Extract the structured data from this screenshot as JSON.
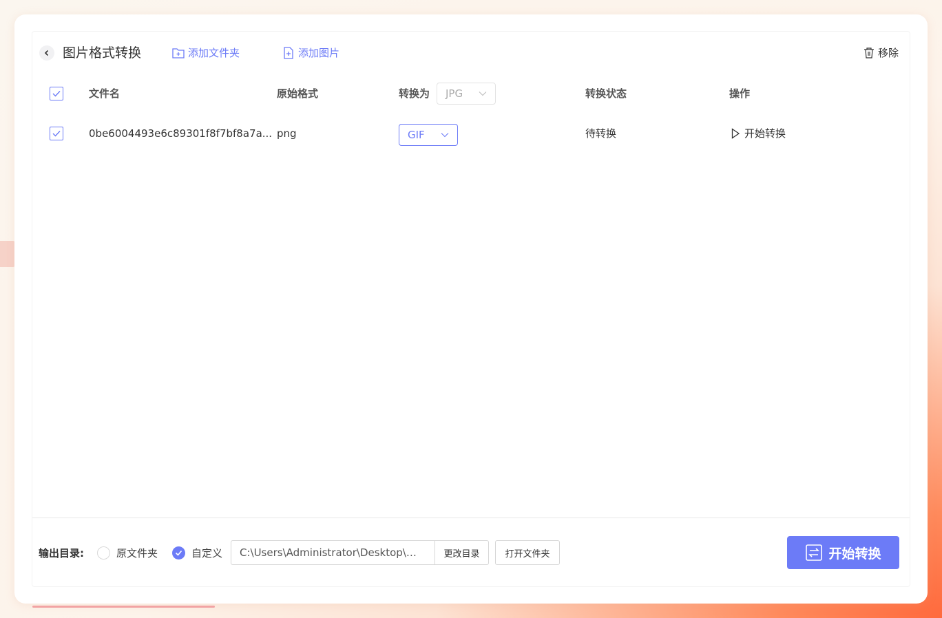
{
  "header": {
    "title": "图片格式转换",
    "add_folder": "添加文件夹",
    "add_image": "添加图片",
    "remove": "移除"
  },
  "table": {
    "columns": {
      "filename": "文件名",
      "original_format": "原始格式",
      "convert_to": "转换为",
      "status": "转换状态",
      "action": "操作"
    },
    "convert_to_all": "JPG",
    "all_checked": true,
    "rows": [
      {
        "checked": true,
        "filename": "0be6004493e6c89301f8f7bf8a7a...",
        "original_format": "png",
        "convert_to": "GIF",
        "status": "待转换",
        "action": "开始转换"
      }
    ]
  },
  "footer": {
    "output_label": "输出目录:",
    "option_original": "原文件夹",
    "option_custom": "自定义",
    "selected_option": "custom",
    "path": "C:\\Users\\Administrator\\Desktop\\万...",
    "change_dir": "更改目录",
    "open_folder": "打开文件夹",
    "start": "开始转换"
  },
  "colors": {
    "accent": "#6c7bf7"
  }
}
